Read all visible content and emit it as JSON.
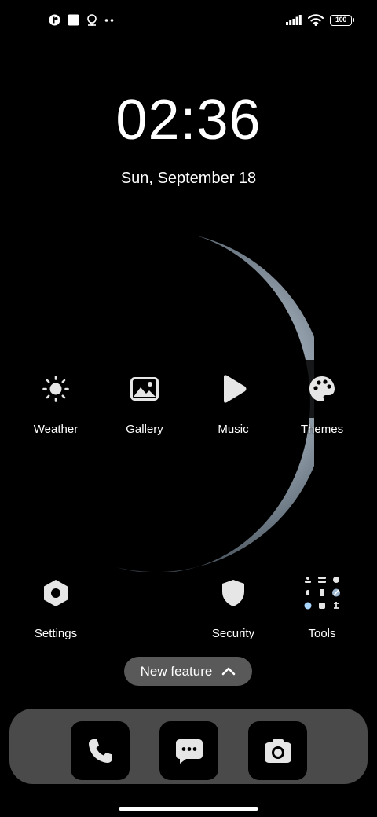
{
  "status_bar": {
    "left_icons": [
      "app-notification-icon",
      "square-notification-icon",
      "location-notification-icon",
      "more-notifications-icon"
    ],
    "right_icons": [
      "signal-icon",
      "wifi-icon",
      "battery-icon"
    ],
    "battery": "100"
  },
  "lockscreen": {
    "time": "02:36",
    "date": "Sun, September 18"
  },
  "apps_row1": [
    {
      "label": "Weather",
      "icon": "sun-icon"
    },
    {
      "label": "Gallery",
      "icon": "image-icon"
    },
    {
      "label": "Music",
      "icon": "play-icon"
    },
    {
      "label": "Themes",
      "icon": "palette-icon"
    }
  ],
  "apps_row2": [
    {
      "label": "Settings",
      "icon": "hexagon-gear-icon"
    },
    {
      "label": "Security",
      "icon": "shield-icon"
    },
    {
      "label": "Tools",
      "icon": "tools-folder-icon"
    }
  ],
  "new_feature": {
    "label": "New feature",
    "icon": "chevron-up-icon"
  },
  "dock": [
    {
      "name": "Phone",
      "icon": "phone-icon"
    },
    {
      "name": "Messages",
      "icon": "message-icon"
    },
    {
      "name": "Camera",
      "icon": "camera-icon"
    }
  ],
  "colors": {
    "background": "#000000",
    "pill": "#595959",
    "dock": "#4a4a4a",
    "icon_fill": "#e6e6e6"
  }
}
